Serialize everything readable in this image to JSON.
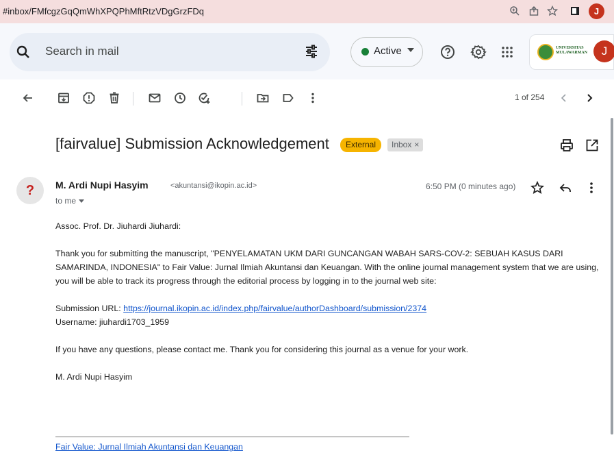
{
  "browser": {
    "url": "#inbox/FMfcgzGqQmWhXPQPhMftRtzVDgGrzFDq",
    "profile_initial": "J"
  },
  "header": {
    "search_placeholder": "Search in mail",
    "status": {
      "label": "Active",
      "color": "#188038"
    },
    "organization_name": "UNIVERSITAS MULAWARMAN",
    "account_initial": "J"
  },
  "toolbar": {
    "icons": [
      "back-icon",
      "archive-icon",
      "report-spam-icon",
      "delete-icon",
      "mark-unread-icon",
      "snooze-icon",
      "add-to-tasks-icon",
      "move-to-icon",
      "label-icon",
      "more-icon"
    ],
    "pagination": "1 of 254"
  },
  "message": {
    "subject": "[fairvalue] Submission Acknowledgement",
    "labels": [
      {
        "text": "External",
        "color": "#f6b400"
      },
      {
        "text": "Inbox",
        "close": "×"
      }
    ],
    "sender_name": "M. Ardi Nupi Hasyim",
    "sender_email": "<akuntansi@ikopin.ac.id>",
    "recipient": "to me",
    "avatar_glyph": "?",
    "time": "6:50 PM (0 minutes ago)",
    "greeting": "Assoc. Prof. Dr. Jiuhardi Jiuhardi:",
    "paragraph": "Thank you for submitting the manuscript, \"PENYELAMATAN UKM DARI GUNCANGAN WABAH SARS-COV-2: SEBUAH KASUS DARI SAMARINDA, INDONESIA\" to Fair Value: Jurnal Ilmiah Akuntansi dan Keuangan. With the online journal management system that we are using, you will be able to track its progress through the editorial process by logging in to the journal web site:",
    "submission_url_label": "Submission URL: ",
    "submission_url": "https://journal.ikopin.ac.id/index.php/fairvalue/authorDashboard/submission/2374",
    "username_line": "Username: jiuhardi1703_1959",
    "closing": "If you have any questions, please contact me. Thank you for considering this journal as a venue for your work.",
    "signature": "M. Ardi Nupi Hasyim",
    "footer_link": "Fair Value: Jurnal Ilmiah Akuntansi dan Keuangan"
  }
}
